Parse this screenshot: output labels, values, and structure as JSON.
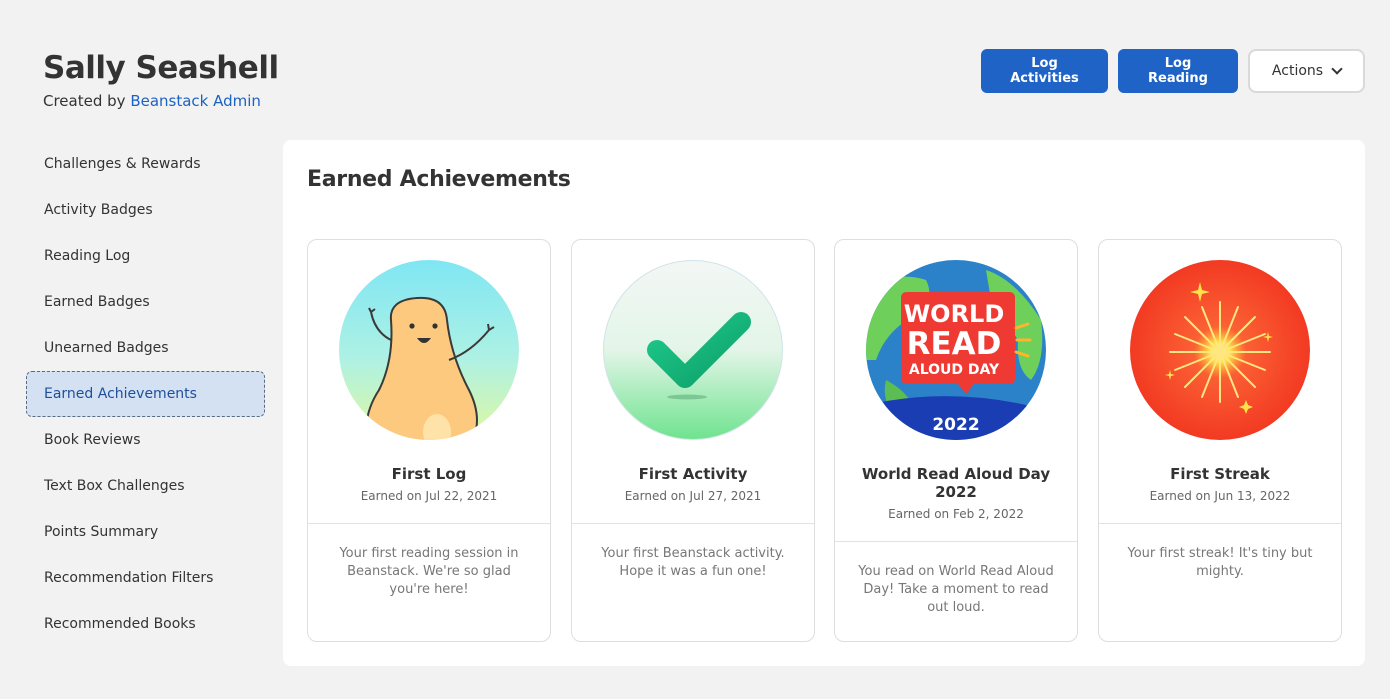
{
  "header": {
    "user_name": "Sally Seashell",
    "created_by_prefix": "Created by",
    "created_by_name": "Beanstack Admin"
  },
  "actions": {
    "log_activities": "Log Activities",
    "log_reading": "Log Reading",
    "actions_menu": "Actions"
  },
  "sidebar": {
    "items": [
      {
        "label": "Challenges & Rewards"
      },
      {
        "label": "Activity Badges"
      },
      {
        "label": "Reading Log"
      },
      {
        "label": "Earned Badges"
      },
      {
        "label": "Unearned Badges"
      },
      {
        "label": "Earned Achievements",
        "active": true
      },
      {
        "label": "Book Reviews"
      },
      {
        "label": "Text Box Challenges"
      },
      {
        "label": "Points Summary"
      },
      {
        "label": "Recommendation Filters"
      },
      {
        "label": "Recommended Books"
      }
    ]
  },
  "main": {
    "title": "Earned Achievements",
    "achievements": [
      {
        "name": "First Log",
        "date": "Earned on Jul 22, 2021",
        "description": "Your first reading session in Beanstack. We're so glad you're here!",
        "icon": "bean-character-icon"
      },
      {
        "name": "First Activity",
        "date": "Earned on Jul 27, 2021",
        "description": "Your first Beanstack activity. Hope it was a fun one!",
        "icon": "checkmark-icon"
      },
      {
        "name": "World Read Aloud Day 2022",
        "date": "Earned on Feb 2, 2022",
        "description": "You read on World Read Aloud Day! Take a moment to read out loud.",
        "icon": "world-read-aloud-day-icon",
        "badge_text": [
          "WORLD",
          "READ",
          "ALOUD DAY",
          "2022"
        ]
      },
      {
        "name": "First Streak",
        "date": "Earned on Jun 13, 2022",
        "description": "Your first streak! It's tiny but mighty.",
        "icon": "firework-icon"
      }
    ]
  },
  "colors": {
    "primary": "#1f63c6",
    "link": "#1a62c4",
    "active_bg": "#d4e1f3"
  }
}
